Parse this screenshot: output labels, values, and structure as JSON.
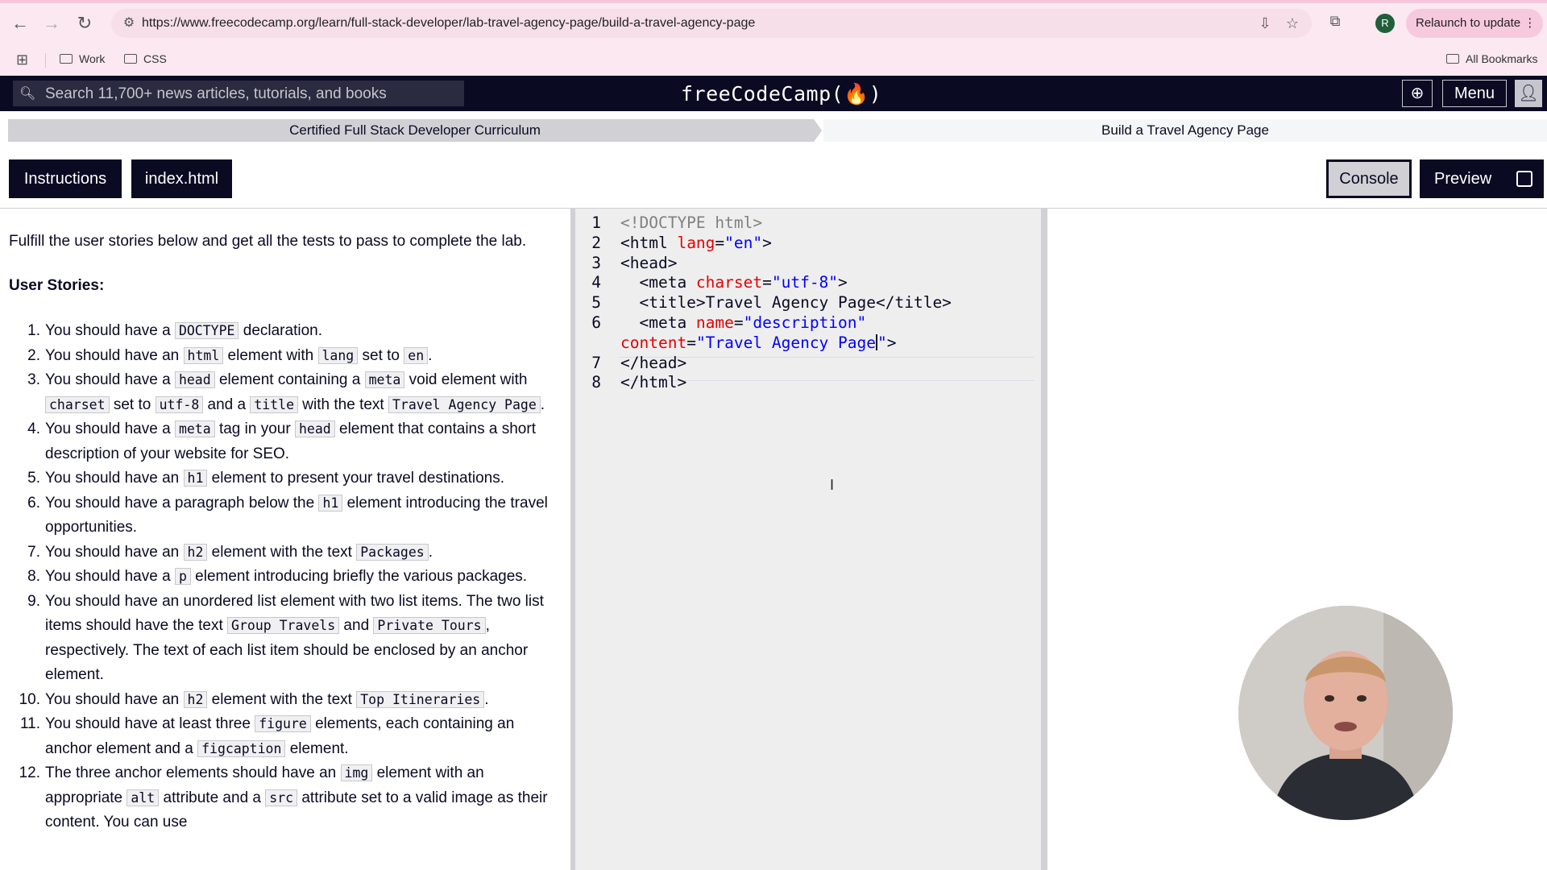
{
  "browser": {
    "url": "https://www.freecodecamp.org/learn/full-stack-developer/lab-travel-agency-page/build-a-travel-agency-page",
    "profile_initial": "R",
    "relaunch_label": "Relaunch to update",
    "bookmarks": [
      "Work",
      "CSS"
    ],
    "all_bookmarks_label": "All Bookmarks"
  },
  "nav": {
    "search_placeholder": "Search 11,700+ news articles, tutorials, and books",
    "logo": "freeCodeCamp(🔥)",
    "menu_label": "Menu"
  },
  "breadcrumb": {
    "curriculum": "Certified Full Stack Developer Curriculum",
    "lab": "Build a Travel Agency Page"
  },
  "tabs": {
    "instructions": "Instructions",
    "file": "index.html",
    "console": "Console",
    "preview": "Preview"
  },
  "instructions": {
    "intro": "Fulfill the user stories below and get all the tests to pass to complete the lab.",
    "heading": "User Stories:",
    "stories": [
      {
        "num": "1.",
        "parts": [
          {
            "t": "You should have a "
          },
          {
            "c": "DOCTYPE"
          },
          {
            "t": " declaration."
          }
        ]
      },
      {
        "num": "2.",
        "parts": [
          {
            "t": "You should have an "
          },
          {
            "c": "html"
          },
          {
            "t": " element with "
          },
          {
            "c": "lang"
          },
          {
            "t": " set to "
          },
          {
            "c": "en"
          },
          {
            "t": "."
          }
        ]
      },
      {
        "num": "3.",
        "parts": [
          {
            "t": "You should have a "
          },
          {
            "c": "head"
          },
          {
            "t": " element containing a "
          },
          {
            "c": "meta"
          },
          {
            "t": " void element with "
          },
          {
            "c": "charset"
          },
          {
            "t": " set to "
          },
          {
            "c": "utf-8"
          },
          {
            "t": " and a "
          },
          {
            "c": "title"
          },
          {
            "t": " with the text "
          },
          {
            "c": "Travel Agency Page"
          },
          {
            "t": "."
          }
        ]
      },
      {
        "num": "4.",
        "parts": [
          {
            "t": "You should have a "
          },
          {
            "c": "meta"
          },
          {
            "t": " tag in your "
          },
          {
            "c": "head"
          },
          {
            "t": " element that contains a short description of your website for SEO."
          }
        ]
      },
      {
        "num": "5.",
        "parts": [
          {
            "t": "You should have an "
          },
          {
            "c": "h1"
          },
          {
            "t": " element to present your travel destinations."
          }
        ]
      },
      {
        "num": "6.",
        "parts": [
          {
            "t": "You should have a paragraph below the "
          },
          {
            "c": "h1"
          },
          {
            "t": " element introducing the travel opportunities."
          }
        ]
      },
      {
        "num": "7.",
        "parts": [
          {
            "t": "You should have an "
          },
          {
            "c": "h2"
          },
          {
            "t": " element with the text "
          },
          {
            "c": "Packages"
          },
          {
            "t": "."
          }
        ]
      },
      {
        "num": "8.",
        "parts": [
          {
            "t": "You should have a "
          },
          {
            "c": "p"
          },
          {
            "t": " element introducing briefly the various packages."
          }
        ]
      },
      {
        "num": "9.",
        "parts": [
          {
            "t": "You should have an unordered list element with two list items. The two list items should have the text "
          },
          {
            "c": "Group Travels"
          },
          {
            "t": " and "
          },
          {
            "c": "Private Tours"
          },
          {
            "t": ", respectively. The text of each list item should be enclosed by an anchor element."
          }
        ]
      },
      {
        "num": "10.",
        "parts": [
          {
            "t": "You should have an "
          },
          {
            "c": "h2"
          },
          {
            "t": " element with the text "
          },
          {
            "c": "Top Itineraries"
          },
          {
            "t": "."
          }
        ]
      },
      {
        "num": "11.",
        "parts": [
          {
            "t": "You should have at least three "
          },
          {
            "c": "figure"
          },
          {
            "t": " elements, each containing an anchor element and a "
          },
          {
            "c": "figcaption"
          },
          {
            "t": " element."
          }
        ]
      },
      {
        "num": "12.",
        "parts": [
          {
            "t": "The three anchor elements should have an "
          },
          {
            "c": "img"
          },
          {
            "t": " element with an appropriate "
          },
          {
            "c": "alt"
          },
          {
            "t": " attribute and a "
          },
          {
            "c": "src"
          },
          {
            "t": " attribute set to a valid image as their content. You can use"
          }
        ]
      }
    ]
  },
  "editor": {
    "line_numbers": [
      "1",
      "2",
      "3",
      "4",
      "5",
      "6",
      "",
      "7",
      "8"
    ],
    "lines": [
      [
        {
          "s": "dt",
          "t": "<!DOCTYPE "
        },
        {
          "s": "dt",
          "t": "html"
        },
        {
          "s": "dt",
          "t": ">"
        }
      ],
      [
        {
          "s": "tg",
          "t": "<html "
        },
        {
          "s": "at",
          "t": "lang"
        },
        {
          "s": "tg",
          "t": "="
        },
        {
          "s": "sv",
          "t": "\"en\""
        },
        {
          "s": "tg",
          "t": ">"
        }
      ],
      [
        {
          "s": "tg",
          "t": "<head>"
        }
      ],
      [
        {
          "s": "tg",
          "t": "  <meta "
        },
        {
          "s": "at",
          "t": "charset"
        },
        {
          "s": "tg",
          "t": "="
        },
        {
          "s": "sv",
          "t": "\"utf-8\""
        },
        {
          "s": "tg",
          "t": ">"
        }
      ],
      [
        {
          "s": "tg",
          "t": "  <title>"
        },
        {
          "s": "tg",
          "t": "Travel Agency Page"
        },
        {
          "s": "tg",
          "t": "</title>"
        }
      ],
      [
        {
          "s": "tg",
          "t": "  <meta "
        },
        {
          "s": "at",
          "t": "name"
        },
        {
          "s": "tg",
          "t": "="
        },
        {
          "s": "sv",
          "t": "\"description\""
        }
      ],
      [
        {
          "s": "at",
          "t": "content"
        },
        {
          "s": "tg",
          "t": "="
        },
        {
          "s": "sv",
          "t": "\"Travel Agency Page"
        },
        {
          "s": "caret",
          "t": ""
        },
        {
          "s": "sv",
          "t": "\""
        },
        {
          "s": "tg",
          "t": ">"
        }
      ],
      [
        {
          "s": "tg",
          "t": "</head>"
        }
      ],
      [
        {
          "s": "tg",
          "t": "</html>"
        }
      ]
    ]
  }
}
